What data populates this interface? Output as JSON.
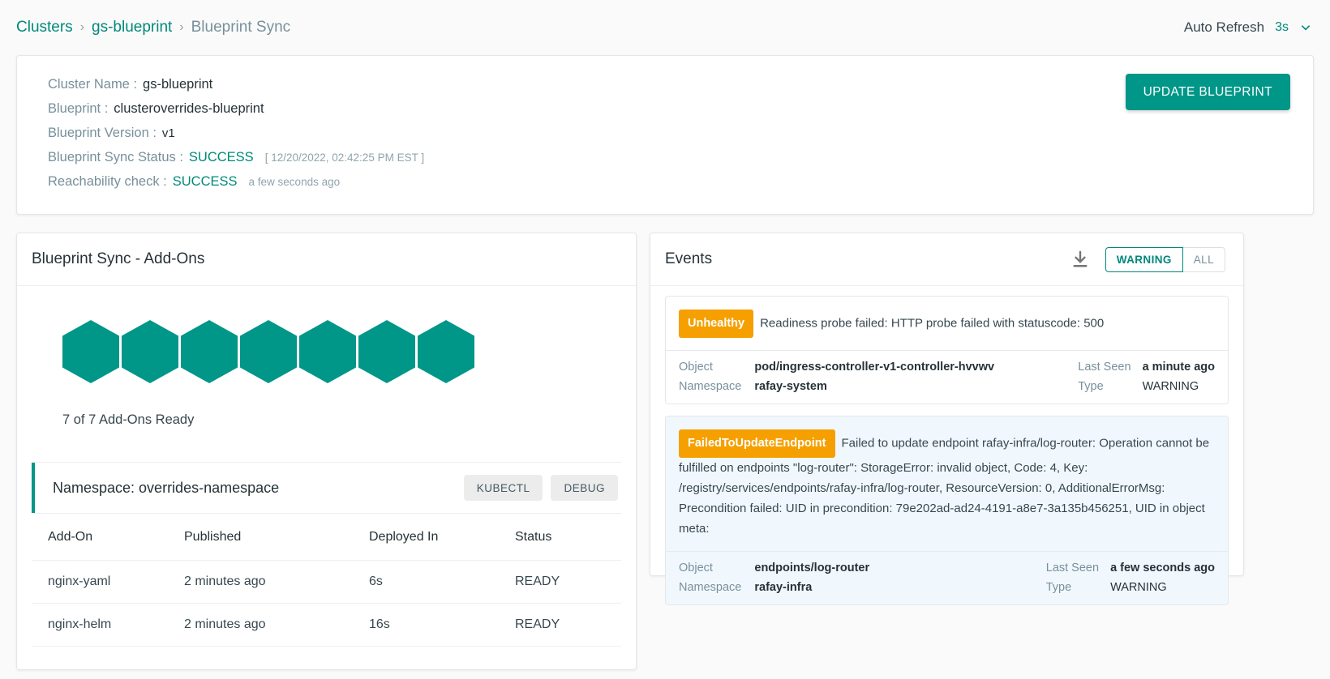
{
  "breadcrumb": {
    "clusters": "Clusters",
    "cluster": "gs-blueprint",
    "current": "Blueprint Sync",
    "separator": "›"
  },
  "auto_refresh": {
    "label": "Auto Refresh",
    "value": "3s"
  },
  "cluster_info": {
    "rows": [
      {
        "label": "Cluster Name :",
        "value": "gs-blueprint",
        "extra": ""
      },
      {
        "label": "Blueprint :",
        "value": "clusteroverrides-blueprint",
        "extra": ""
      },
      {
        "label": "Blueprint Version :",
        "value": "v1",
        "extra": ""
      },
      {
        "label": "Blueprint Sync Status :",
        "value": "SUCCESS",
        "extra": "[ 12/20/2022, 02:42:25 PM EST ]"
      },
      {
        "label": "Reachability check :",
        "value": "SUCCESS",
        "extra": "a few seconds ago"
      }
    ],
    "update_button": "UPDATE BLUEPRINT"
  },
  "addons": {
    "title": "Blueprint Sync - Add-Ons",
    "hex_count": 7,
    "ready_text": "7 of 7 Add-Ons Ready",
    "namespace": {
      "title": "Namespace: overrides-namespace",
      "kubectl_button": "KUBECTL",
      "debug_button": "DEBUG"
    },
    "table": {
      "columns": [
        "Add-On",
        "Published",
        "Deployed In",
        "Status"
      ],
      "rows": [
        {
          "addon": "nginx-yaml",
          "published": "2 minutes ago",
          "deployed_in": "6s",
          "status": "READY"
        },
        {
          "addon": "nginx-helm",
          "published": "2 minutes ago",
          "deployed_in": "16s",
          "status": "READY"
        }
      ]
    }
  },
  "events": {
    "title": "Events",
    "filter_warning": "WARNING",
    "filter_all": "ALL",
    "items": [
      {
        "badge": "Unhealthy",
        "message": "Readiness probe failed: HTTP probe failed with statuscode: 500",
        "object_label": "Object",
        "object_value": "pod/ingress-controller-v1-controller-hvvwv",
        "namespace_label": "Namespace",
        "namespace_value": "rafay-system",
        "last_seen_label": "Last Seen",
        "last_seen_value": "a minute ago",
        "type_label": "Type",
        "type_value": "WARNING"
      },
      {
        "badge": "FailedToUpdateEndpoint",
        "message": "Failed to update endpoint rafay-infra/log-router: Operation cannot be fulfilled on endpoints \"log-router\": StorageError: invalid object, Code: 4, Key: /registry/services/endpoints/rafay-infra/log-router, ResourceVersion: 0, AdditionalErrorMsg: Precondition failed: UID in precondition: 79e202ad-ad24-4191-a8e7-3a135b456251, UID in object meta:",
        "object_label": "Object",
        "object_value": "endpoints/log-router",
        "namespace_label": "Namespace",
        "namespace_value": "rafay-infra",
        "last_seen_label": "Last Seen",
        "last_seen_value": "a few seconds ago",
        "type_label": "Type",
        "type_value": "WARNING"
      }
    ]
  },
  "colors": {
    "teal": "#009688",
    "teal_text": "#00897b",
    "orange_badge": "#f5a000",
    "highlight_bg": "#f1f8fd"
  }
}
